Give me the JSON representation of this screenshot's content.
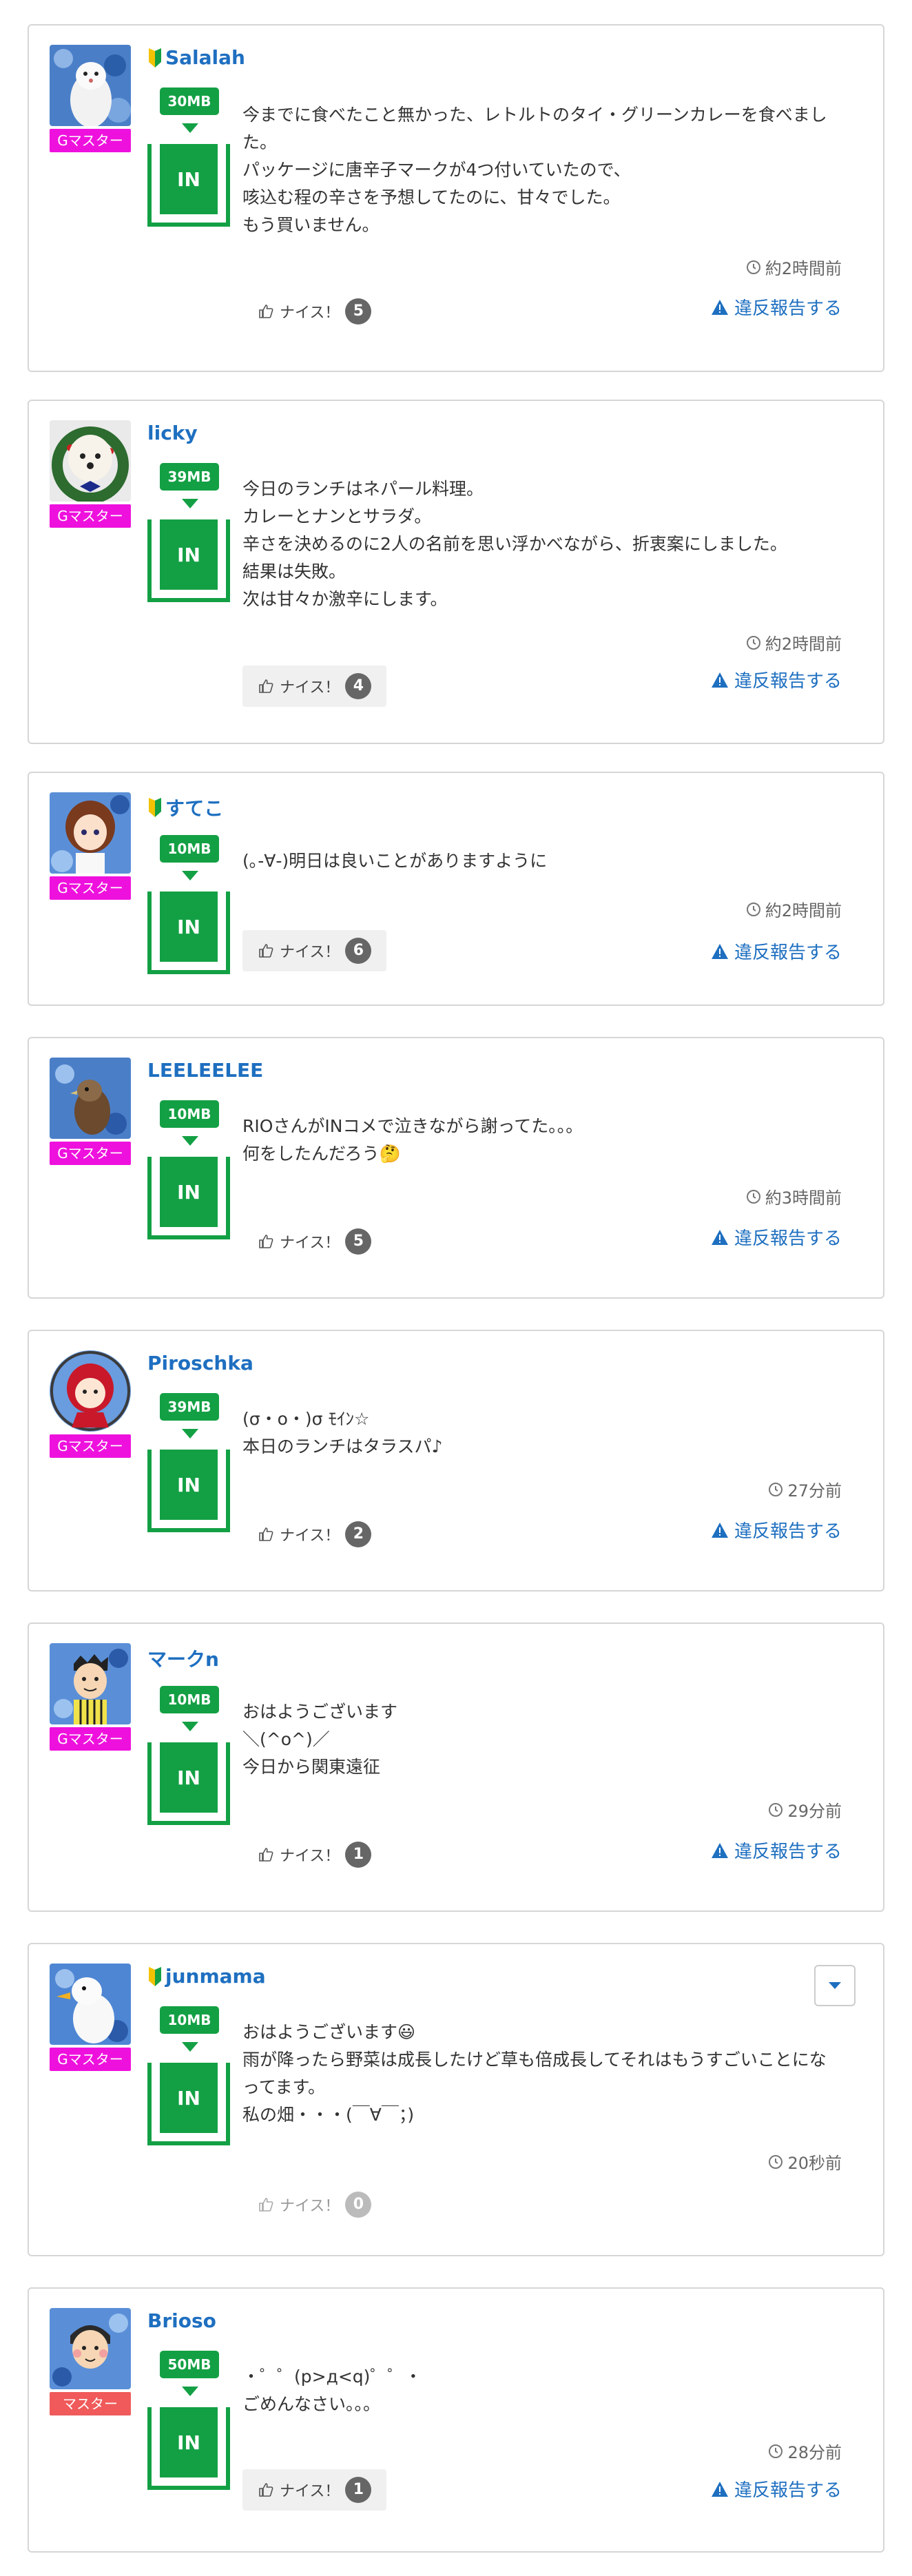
{
  "labels": {
    "in": "IN",
    "nice": "ナイス！",
    "report": "違反報告する"
  },
  "colors": {
    "accent_green": "#13a044",
    "link_blue": "#1e6fc0",
    "rank_gmaster": "#ee11dd",
    "rank_master": "#f05a5a"
  },
  "posts": [
    {
      "username": "Salalah",
      "beginner": true,
      "avatar_icon": "ferret-avatar",
      "rank": "Gマスター",
      "mb": "30MB",
      "comment": "今までに食べたこと無かった、レトルトのタイ・グリーンカレーを食べました。\nパッケージに唐辛子マークが4つ付いていたので、\n咳込む程の辛さを予想してたのに、甘々でした。\nもう買いません。",
      "time": "約2時間前",
      "nice_count": "5"
    },
    {
      "username": "licky",
      "beginner": false,
      "avatar_icon": "dog-wreath-avatar",
      "rank": "Gマスター",
      "mb": "39MB",
      "comment": "今日のランチはネパール料理。\nカレーとナンとサラダ。\n辛さを決めるのに2人の名前を思い浮かべながら、折衷案にしました。\n結果は失敗。\n次は甘々か激辛にします。",
      "time": "約2時間前",
      "nice_count": "4"
    },
    {
      "username": "すてこ",
      "beginner": true,
      "avatar_icon": "anime-girl-avatar",
      "rank": "Gマスター",
      "mb": "10MB",
      "comment": "(｡-∀-)明日は良いことがありますように",
      "time": "約2時間前",
      "nice_count": "6"
    },
    {
      "username": "LEELEELEE",
      "beginner": false,
      "avatar_icon": "bird-avatar",
      "rank": "Gマスター",
      "mb": "10MB",
      "comment": "RIOさんがINコメで泣きながら謝ってた。。。\n何をしたんだろう🤔",
      "time": "約3時間前",
      "nice_count": "5"
    },
    {
      "username": "Piroschka",
      "beginner": false,
      "avatar_icon": "red-hood-avatar",
      "rank": "Gマスター",
      "mb": "39MB",
      "comment": "(σ・o・)σ ﾓｲﾝ☆\n本日のランチはタラスパ♪",
      "time": "27分前",
      "nice_count": "2"
    },
    {
      "username": "マークn",
      "beginner": false,
      "avatar_icon": "man-avatar",
      "rank": "Gマスター",
      "mb": "10MB",
      "comment": "おはようございます\n＼(^o^)／\n今日から関東遠征",
      "time": "29分前",
      "nice_count": "1"
    },
    {
      "username": "junmama",
      "beginner": true,
      "avatar_icon": "duck-avatar",
      "rank": "Gマスター",
      "mb": "10MB",
      "comment": "おはようございます😃\n雨が降ったら野菜は成長したけど草も倍成長してそれはもうすごいことになってます。\n私の畑・・・(￣∀￣；)",
      "time": "20秒前",
      "nice_count": "0"
    },
    {
      "username": "Brioso",
      "beginner": false,
      "avatar_icon": "boy-avatar",
      "rank": "マスター",
      "mb": "50MB",
      "comment": "・゜゜(p>д<q)゜゜・\nごめんなさい。。。",
      "time": "28分前",
      "nice_count": "1"
    }
  ]
}
